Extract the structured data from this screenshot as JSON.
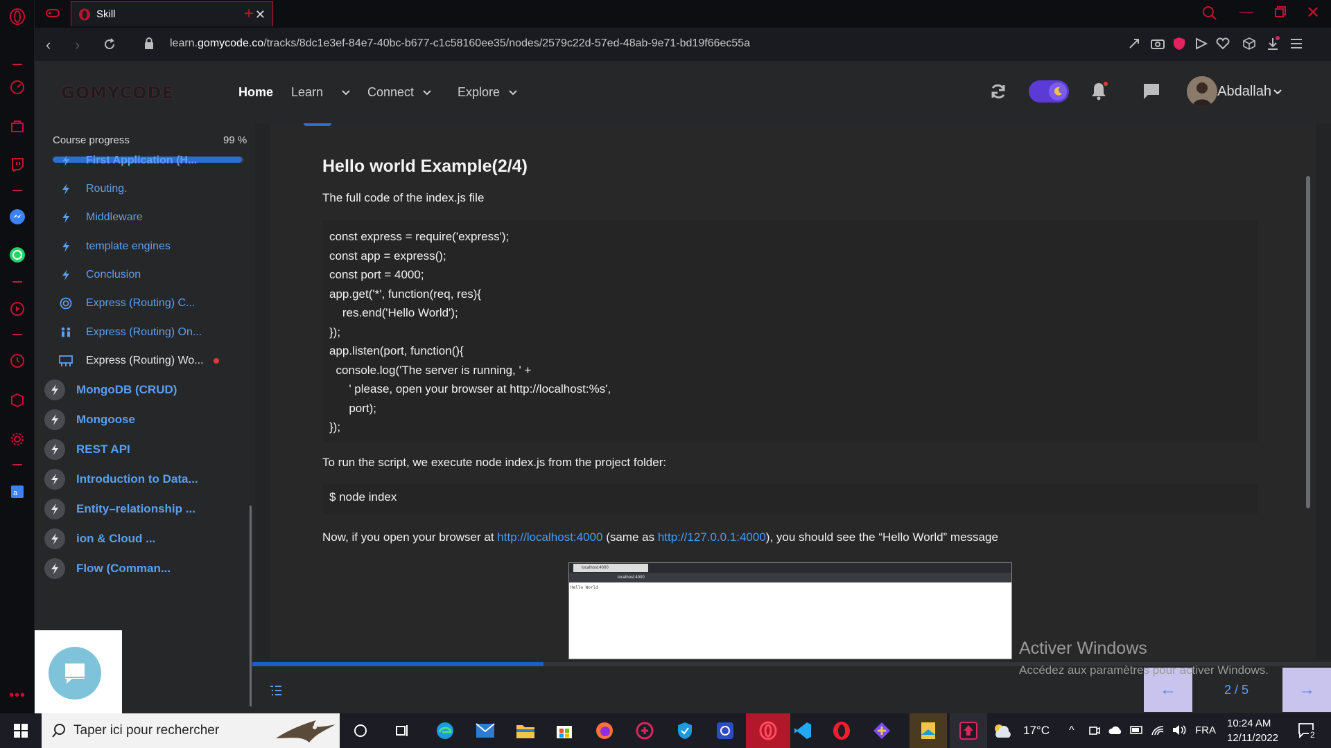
{
  "browser": {
    "tab_title": "Skill",
    "url_prefix": "learn.",
    "url_domain": "gomycode.co",
    "url_path": "/tracks/8dc1e3ef-84e7-40bc-b677-c1c58160ee35/nodes/2579c22d-57ed-48ab-9e71-bd19f66ec55a"
  },
  "header": {
    "logo": "GOMYCODE",
    "nav": [
      "Home",
      "Learn",
      "Connect",
      "Explore"
    ],
    "user_name": "Abdallah"
  },
  "course": {
    "progress_label": "Course progress",
    "progress_value": "99 %",
    "progress_fraction": 0.99,
    "sub_items": [
      {
        "label": "First Application (H...",
        "icon": "bolt-icon",
        "bold": true
      },
      {
        "label": "Routing.",
        "icon": "bolt-icon"
      },
      {
        "label": "Middleware",
        "icon": "bolt-icon"
      },
      {
        "label": "template engines",
        "icon": "bolt-icon"
      },
      {
        "label": "Conclusion",
        "icon": "bolt-icon"
      },
      {
        "label": "Express (Routing) C...",
        "icon": "target-icon"
      },
      {
        "label": "Express (Routing) On...",
        "icon": "people-icon"
      },
      {
        "label": "Express (Routing) Wo...",
        "icon": "workshop-icon",
        "current": true
      }
    ],
    "main_items": [
      "MongoDB (CRUD)",
      "Mongoose",
      "REST API",
      "Introduction to Data...",
      "Entity–relationship ...",
      "ion & Cloud ...",
      "Flow (Comman..."
    ]
  },
  "lesson": {
    "title": "Hello world Example(2/4)",
    "intro": "The full code of the index.js file",
    "code": [
      "const express = require('express');",
      "const app = express();",
      "const port = 4000;",
      "app.get('*', function(req, res){",
      "    res.end('Hello World');",
      "});",
      "app.listen(port, function(){",
      "  console.log('The server is running, ' +",
      "      ' please, open your browser at http://localhost:%s',",
      "      port);",
      "});"
    ],
    "run_text": "To run the script, we execute node index.js from the project folder:",
    "command": "$ node index",
    "open_text_1": "Now, if you open your browser at ",
    "link_1": "http://localhost:4000",
    "open_text_2": " (same as ",
    "link_2": "http://127.0.0.1:4000",
    "open_text_3": "), you should see the “Hello World” message",
    "screenshot_tab": "localhost:4000",
    "screenshot_url": "localhost:4000",
    "screenshot_body": "Hello World"
  },
  "pager": {
    "text": "2 / 5",
    "prev": "←",
    "next": "→",
    "lesson_fraction": 0.27
  },
  "watermark": {
    "title": "Activer Windows",
    "subtitle": "Accédez aux paramètres pour activer Windows."
  },
  "taskbar": {
    "search_placeholder": "Taper ici pour rechercher",
    "temperature": "17°C",
    "language": "FRA",
    "time": "10:24 AM",
    "date": "12/11/2022",
    "notification_count": "2"
  },
  "colors": {
    "accent": "#2d6fd0",
    "link": "#5aa0f2",
    "opera_red": "#c8102e"
  }
}
